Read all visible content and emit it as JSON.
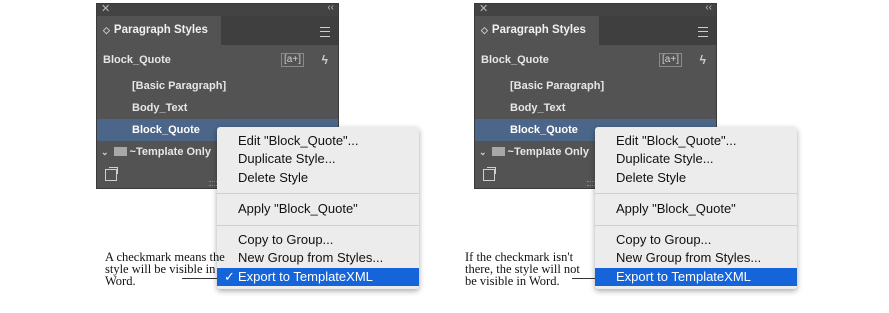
{
  "panel": {
    "title": "Paragraph Styles",
    "close_glyph": "✕",
    "collapse_glyph": "‹‹",
    "tab_arrows_glyph": "◇",
    "current_style": "Block_Quote",
    "new_style_glyph": "[a+]",
    "quick_apply_glyph": "ϟ",
    "styles": [
      "[Basic Paragraph]",
      "Body_Text",
      "Block_Quote"
    ],
    "selected_style": "Block_Quote",
    "group_name": "~Template Only",
    "group_chevron": "⌄"
  },
  "menu": {
    "edit": "Edit \"Block_Quote\"...",
    "duplicate": "Duplicate Style...",
    "delete": "Delete Style",
    "apply": "Apply \"Block_Quote\"",
    "copy_to_group": "Copy to Group...",
    "new_group": "New Group from Styles...",
    "export": "Export to TemplateXML",
    "checkmark": "✓"
  },
  "notes": {
    "left": "A checkmark means the style will be visible in Word.",
    "right": "If the checkmark isn't there, the style will not be visible in Word."
  },
  "colors": {
    "panel_bg": "#535353",
    "selected_row": "#4b6688",
    "menu_highlight": "#1564d9"
  }
}
